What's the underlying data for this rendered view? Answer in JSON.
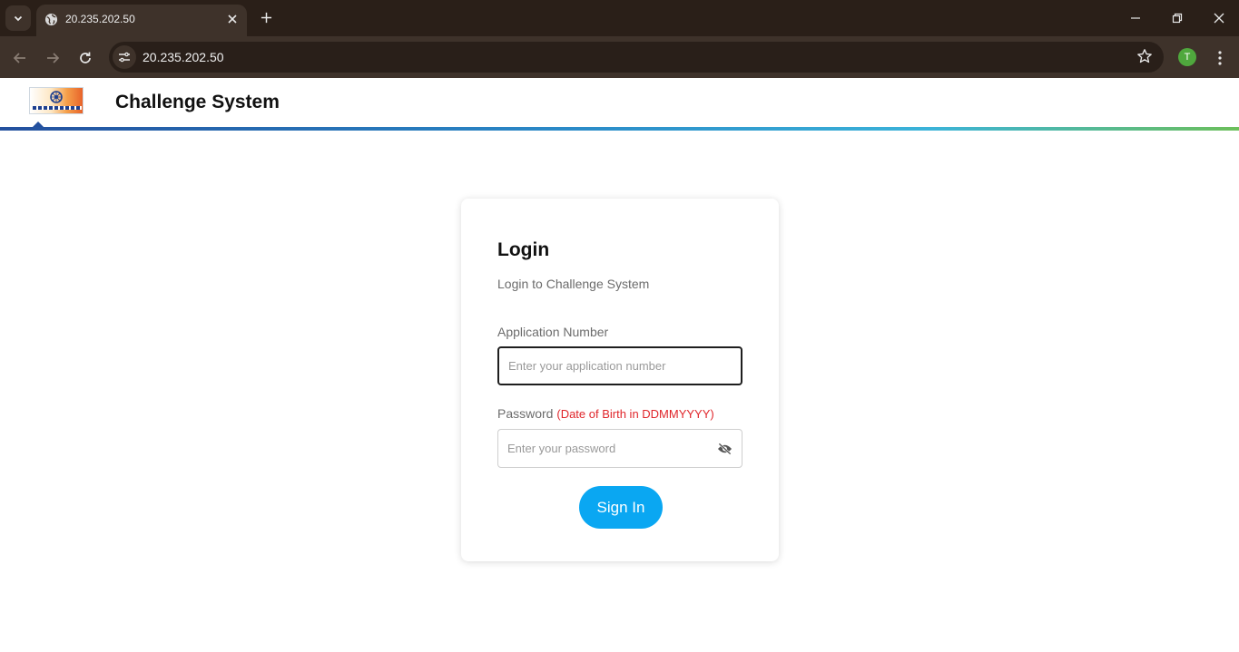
{
  "browser": {
    "tab_title": "20.235.202.50",
    "url": "20.235.202.50",
    "profile_initial": "T"
  },
  "site": {
    "title": "Challenge System"
  },
  "login": {
    "title": "Login",
    "subtitle": "Login to Challenge System",
    "app_number_label": "Application Number",
    "app_number_placeholder": "Enter your application number",
    "password_label": "Password",
    "password_hint": "(Date of Birth in DDMMYYYY)",
    "password_placeholder": "Enter your password",
    "sign_in_label": "Sign In"
  },
  "colors": {
    "sign_in_button": "#0aa7f2",
    "password_hint": "#e0262b",
    "header_gradient_start": "#23509e",
    "header_gradient_end": "#6cbf5a"
  },
  "icons": {
    "tab_dropdown": "chevron-down-icon",
    "favicon": "globe-icon",
    "tab_close": "close-icon",
    "new_tab": "plus-icon",
    "back": "arrow-left-icon",
    "forward": "arrow-right-icon",
    "reload": "reload-icon",
    "site_info": "tune-icon",
    "bookmark": "star-icon",
    "menu": "kebab-menu-icon",
    "password_visibility": "eye-off-icon"
  }
}
